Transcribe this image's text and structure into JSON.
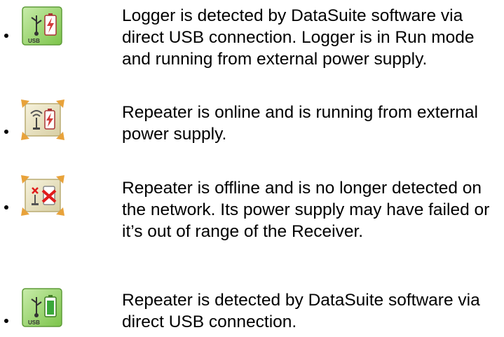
{
  "items": [
    {
      "icon": "usb-logger-external-power-icon",
      "text": "Logger is detected by DataSuite software via direct USB connection. Logger is in Run mode and running from external power supply."
    },
    {
      "icon": "repeater-online-external-power-icon",
      "text": "Repeater is online and is running from external power supply."
    },
    {
      "icon": "repeater-offline-icon",
      "text": "Repeater is offline and is no longer detected on the network. Its power supply may have failed or it’s out of range of the Receiver."
    },
    {
      "icon": "usb-repeater-battery-icon",
      "text": "Repeater is detected by DataSuite software via direct USB connection."
    }
  ],
  "colors": {
    "icon_green": "#9bd66a",
    "icon_cream": "#efe8c8",
    "corner_orange": "#e8a23a",
    "battery_red": "#d23a3a",
    "error_red": "#e01b1b"
  }
}
